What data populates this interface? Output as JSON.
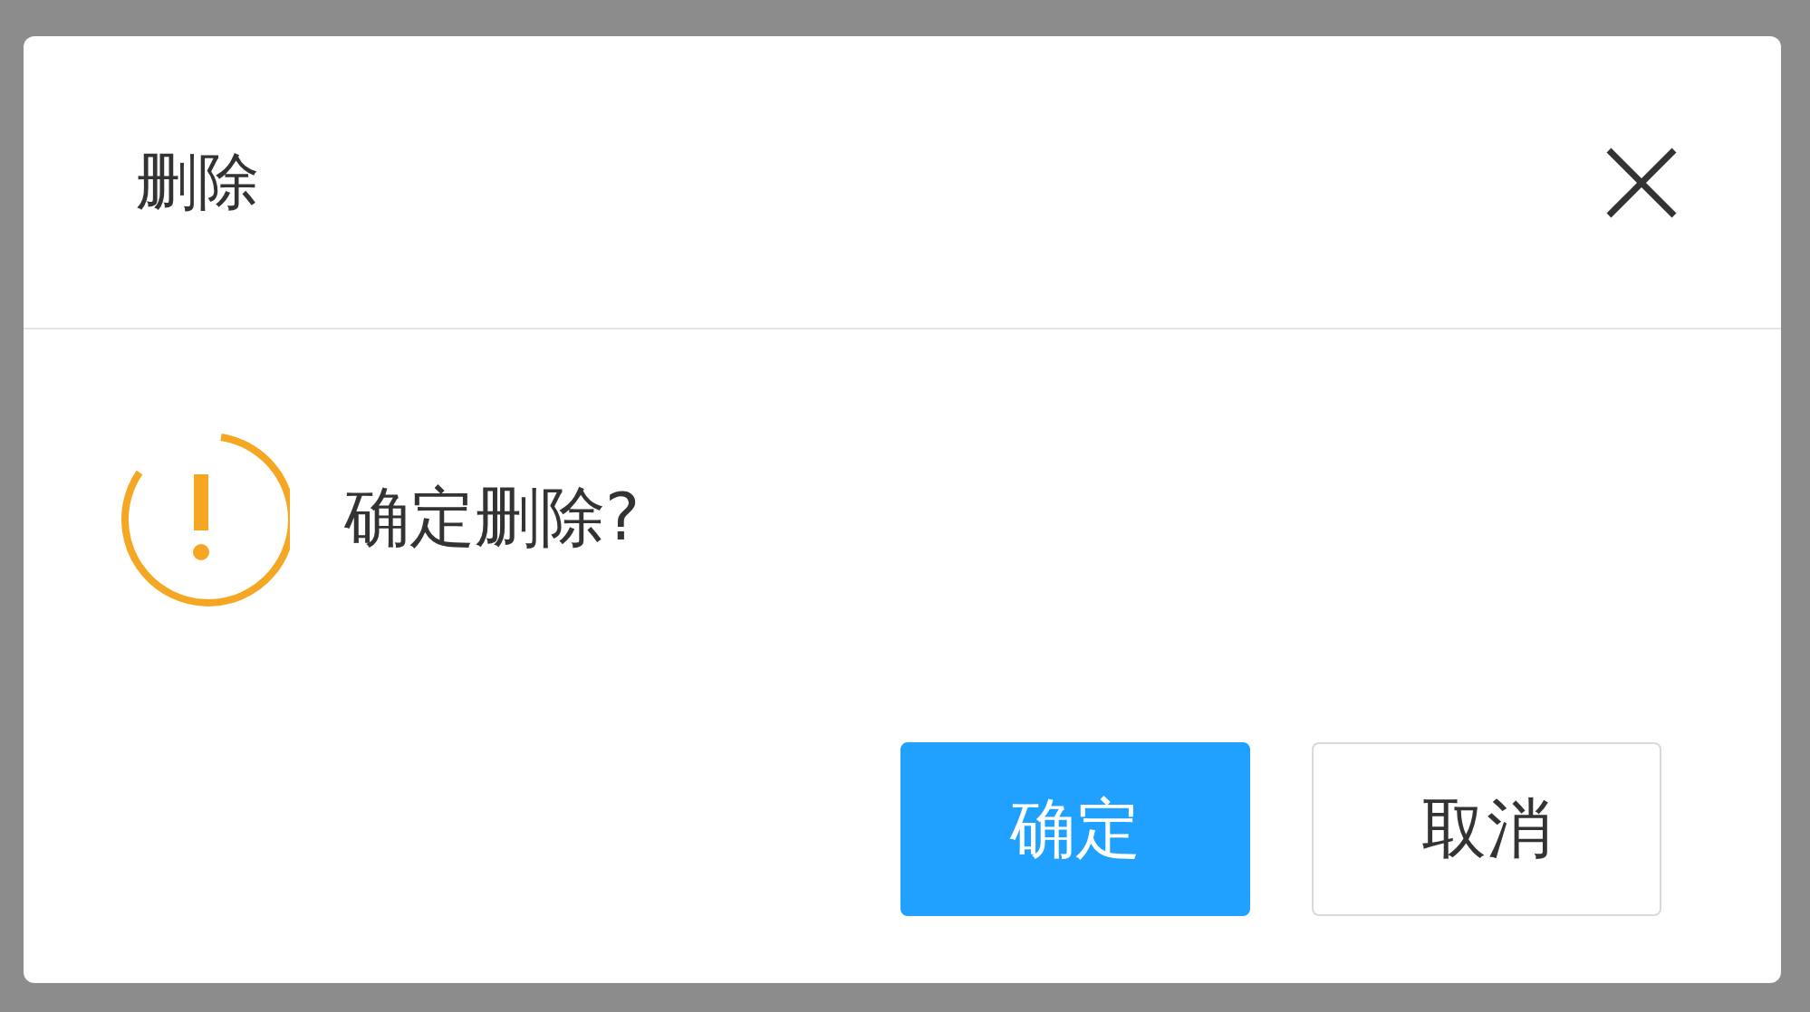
{
  "dialog": {
    "title": "删除",
    "message": "确定删除?",
    "icon": {
      "kind": "warning"
    },
    "buttons": [
      {
        "label": "确定",
        "kind": "primary"
      },
      {
        "label": "取消",
        "kind": "default"
      }
    ]
  }
}
